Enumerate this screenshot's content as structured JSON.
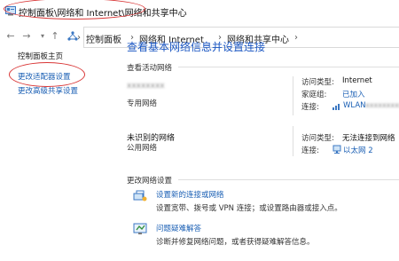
{
  "window": {
    "title": "控制面板\\网络和 Internet\\网络和共享中心"
  },
  "nav": {
    "back_icon": "back-arrow-icon",
    "forward_icon": "forward-arrow-icon",
    "recent_icon": "chevron-down-icon",
    "up_icon": "up-arrow-icon",
    "breadcrumbs": [
      "控制面板",
      "网络和 Internet",
      "网络和共享中心"
    ],
    "separator": "›"
  },
  "sidebar": {
    "home": "控制面板主页",
    "items": [
      "更改适配器设置",
      "更改高级共享设置"
    ]
  },
  "main": {
    "title": "查看基本网络信息并设置连接",
    "active_networks_label": "查看活动网络",
    "networks": [
      {
        "name": "",
        "name_obscured": "xxxxxxxx",
        "type": "专用网络",
        "access_type_key": "访问类型:",
        "access_type_val": "Internet",
        "homegroup_key": "家庭组:",
        "homegroup_val": "已加入",
        "connection_key": "连接:",
        "connection_val": "WLAN",
        "connection_obscured": "xxxxxxxxx"
      },
      {
        "name": "未识别的网络",
        "type": "公用网络",
        "access_type_key": "访问类型:",
        "access_type_val": "无法连接到网络",
        "connection_key": "连接:",
        "connection_val": "以太网 2"
      }
    ],
    "change_settings_label": "更改网络设置",
    "tasks": [
      {
        "link": "设置新的连接或网络",
        "desc": "设置宽带、拨号或 VPN 连接；或设置路由器或接入点。",
        "icon": "new-connection-icon"
      },
      {
        "link": "问题疑难解答",
        "desc": "诊断并修复网络问题，或者获得疑难解答信息。",
        "icon": "troubleshoot-icon"
      }
    ]
  },
  "colors": {
    "link": "#1a5fb4",
    "title": "#1a56c2",
    "highlight": "#d93636"
  }
}
